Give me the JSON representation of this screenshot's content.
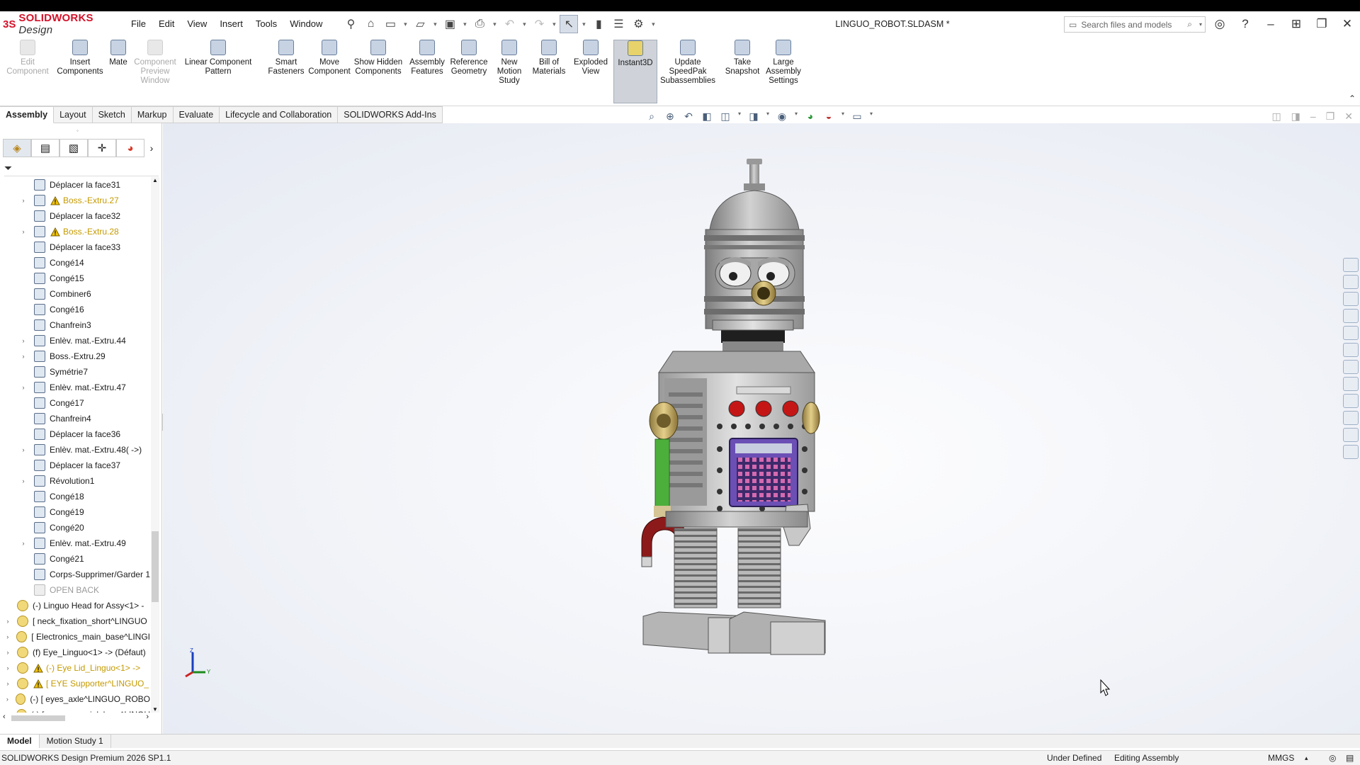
{
  "app": {
    "brand_prefix": "SOLIDWORKS",
    "brand_suffix": "Design",
    "document_title": "LINGUO_ROBOT.SLDASM *"
  },
  "menu": [
    "File",
    "Edit",
    "View",
    "Insert",
    "Tools",
    "Window"
  ],
  "search": {
    "placeholder": "Search files and models"
  },
  "commands": [
    {
      "label": "Edit Component",
      "disabled": true
    },
    {
      "label": "Insert Components",
      "disabled": false
    },
    {
      "label": "Mate",
      "disabled": false
    },
    {
      "label": "Component Preview Window",
      "disabled": true
    },
    {
      "label": "Linear Component Pattern",
      "disabled": false
    },
    {
      "label": "Smart Fasteners",
      "disabled": false
    },
    {
      "label": "Move Component",
      "disabled": false
    },
    {
      "label": "Show Hidden Components",
      "disabled": false
    },
    {
      "label": "Assembly Features",
      "disabled": false
    },
    {
      "label": "Reference Geometry",
      "disabled": false
    },
    {
      "label": "New Motion Study",
      "disabled": false
    },
    {
      "label": "Bill of Materials",
      "disabled": false
    },
    {
      "label": "Exploded View",
      "disabled": false
    },
    {
      "label": "Instant3D",
      "disabled": false,
      "active": true
    },
    {
      "label": "Update SpeedPak Subassemblies",
      "disabled": false
    },
    {
      "label": "Take Snapshot",
      "disabled": false
    },
    {
      "label": "Large Assembly Settings",
      "disabled": false
    }
  ],
  "tabs": [
    "Assembly",
    "Layout",
    "Sketch",
    "Markup",
    "Evaluate",
    "Lifecycle and Collaboration",
    "SOLIDWORKS Add-Ins"
  ],
  "active_tab": "Assembly",
  "tree": [
    {
      "label": "Déplacer la face31",
      "expandable": false,
      "warning": false,
      "style": "normal"
    },
    {
      "label": "Boss.-Extru.27",
      "expandable": true,
      "warning": true,
      "style": "yel"
    },
    {
      "label": "Déplacer la face32",
      "expandable": false,
      "warning": false,
      "style": "normal"
    },
    {
      "label": "Boss.-Extru.28",
      "expandable": true,
      "warning": true,
      "style": "yel"
    },
    {
      "label": "Déplacer la face33",
      "expandable": false,
      "warning": false,
      "style": "normal"
    },
    {
      "label": "Congé14",
      "expandable": false,
      "warning": false,
      "style": "normal"
    },
    {
      "label": "Congé15",
      "expandable": false,
      "warning": false,
      "style": "normal"
    },
    {
      "label": "Combiner6",
      "expandable": false,
      "warning": false,
      "style": "normal"
    },
    {
      "label": "Congé16",
      "expandable": false,
      "warning": false,
      "style": "normal"
    },
    {
      "label": "Chanfrein3",
      "expandable": false,
      "warning": false,
      "style": "normal"
    },
    {
      "label": "Enlèv. mat.-Extru.44",
      "expandable": true,
      "warning": false,
      "style": "normal"
    },
    {
      "label": "Boss.-Extru.29",
      "expandable": true,
      "warning": false,
      "style": "normal"
    },
    {
      "label": "Symétrie7",
      "expandable": false,
      "warning": false,
      "style": "normal"
    },
    {
      "label": "Enlèv. mat.-Extru.47",
      "expandable": true,
      "warning": false,
      "style": "normal"
    },
    {
      "label": "Congé17",
      "expandable": false,
      "warning": false,
      "style": "normal"
    },
    {
      "label": "Chanfrein4",
      "expandable": false,
      "warning": false,
      "style": "normal"
    },
    {
      "label": "Déplacer la face36",
      "expandable": false,
      "warning": false,
      "style": "normal"
    },
    {
      "label": "Enlèv. mat.-Extru.48( ->)",
      "expandable": true,
      "warning": false,
      "style": "normal"
    },
    {
      "label": "Déplacer la face37",
      "expandable": false,
      "warning": false,
      "style": "normal"
    },
    {
      "label": "Révolution1",
      "expandable": true,
      "warning": false,
      "style": "normal"
    },
    {
      "label": "Congé18",
      "expandable": false,
      "warning": false,
      "style": "normal"
    },
    {
      "label": "Congé19",
      "expandable": false,
      "warning": false,
      "style": "normal"
    },
    {
      "label": "Congé20",
      "expandable": false,
      "warning": false,
      "style": "normal"
    },
    {
      "label": "Enlèv. mat.-Extru.49",
      "expandable": true,
      "warning": false,
      "style": "normal"
    },
    {
      "label": "Congé21",
      "expandable": false,
      "warning": false,
      "style": "normal"
    },
    {
      "label": "Corps-Supprimer/Garder 1",
      "expandable": false,
      "warning": false,
      "style": "normal"
    },
    {
      "label": "OPEN BACK",
      "expandable": false,
      "warning": false,
      "style": "grey"
    },
    {
      "label": "(-) Linguo Head for Assy<1> -",
      "expandable": false,
      "warning": false,
      "style": "normal",
      "level": 0
    },
    {
      "label": "[ neck_fixation_short^LINGUO",
      "expandable": true,
      "warning": false,
      "style": "normal",
      "level": 0
    },
    {
      "label": "[ Electronics_main_base^LINGI",
      "expandable": true,
      "warning": false,
      "style": "normal",
      "level": 0
    },
    {
      "label": "(f) Eye_Linguo<1> -> (Défaut)",
      "expandable": true,
      "warning": false,
      "style": "normal",
      "level": 0
    },
    {
      "label": "(-) Eye Lid_Linguo<1> ->",
      "expandable": true,
      "warning": true,
      "style": "yel",
      "level": 0
    },
    {
      "label": "[ EYE Supporter^LINGUO_",
      "expandable": true,
      "warning": true,
      "style": "yel",
      "level": 0
    },
    {
      "label": "(-) [ eyes_axle^LINGUO_ROBO",
      "expandable": true,
      "warning": false,
      "style": "normal",
      "level": 0
    },
    {
      "label": "(-) [ servo_special_horn^LINGU",
      "expandable": true,
      "warning": false,
      "style": "normal",
      "level": 0
    }
  ],
  "bottom_tabs": [
    "Model",
    "Motion Study 1"
  ],
  "status": {
    "product": "SOLIDWORKS Design Premium 2026 SP1.1",
    "definition": "Under Defined",
    "mode": "Editing Assembly",
    "units": "MMGS"
  },
  "triad": {
    "z": "Z",
    "y": "Y"
  },
  "colors": {
    "brand": "#d3122a",
    "warning": "#c49a00",
    "panel_eye": "#7a4fb5",
    "led": "#d11818"
  }
}
